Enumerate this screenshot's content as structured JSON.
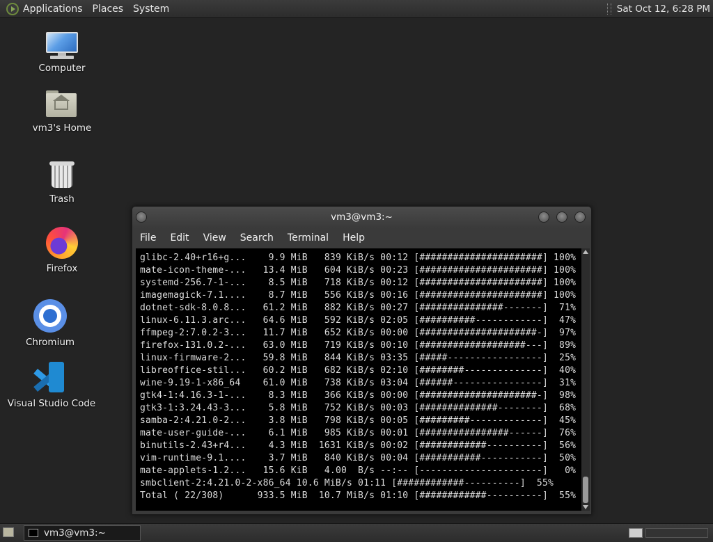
{
  "top_panel": {
    "menus": [
      "Applications",
      "Places",
      "System"
    ],
    "clock": "Sat Oct 12,  6:28 PM"
  },
  "desktop": {
    "icons": [
      {
        "label": "Computer",
        "icon": "computer-icon"
      },
      {
        "label": "vm3's Home",
        "icon": "home-folder-icon"
      },
      {
        "label": "Trash",
        "icon": "trash-icon"
      },
      {
        "label": "Firefox",
        "icon": "firefox-icon"
      },
      {
        "label": "Chromium",
        "icon": "chromium-icon"
      },
      {
        "label": "Visual Studio Code",
        "icon": "vscode-icon"
      }
    ]
  },
  "terminal": {
    "title": "vm3@vm3:~",
    "menu": [
      "File",
      "Edit",
      "View",
      "Search",
      "Terminal",
      "Help"
    ],
    "rows": [
      {
        "name": "glibc-2.40+r16+g...",
        "size": "9.9 MiB",
        "rate": "839 KiB/s",
        "time": "00:12",
        "bar": "[######################]",
        "percent": "100%"
      },
      {
        "name": "mate-icon-theme-...",
        "size": "13.4 MiB",
        "rate": "604 KiB/s",
        "time": "00:23",
        "bar": "[######################]",
        "percent": "100%"
      },
      {
        "name": "systemd-256.7-1-...",
        "size": "8.5 MiB",
        "rate": "718 KiB/s",
        "time": "00:12",
        "bar": "[######################]",
        "percent": "100%"
      },
      {
        "name": "imagemagick-7.1....",
        "size": "8.7 MiB",
        "rate": "556 KiB/s",
        "time": "00:16",
        "bar": "[######################]",
        "percent": "100%"
      },
      {
        "name": "dotnet-sdk-8.0.8...",
        "size": "61.2 MiB",
        "rate": "882 KiB/s",
        "time": "00:27",
        "bar": "[###############-------]",
        "percent": "71%"
      },
      {
        "name": "linux-6.11.3.arc...",
        "size": "64.6 MiB",
        "rate": "592 KiB/s",
        "time": "02:05",
        "bar": "[##########------------]",
        "percent": "47%"
      },
      {
        "name": "ffmpeg-2:7.0.2-3...",
        "size": "11.7 MiB",
        "rate": "652 KiB/s",
        "time": "00:00",
        "bar": "[#####################-]",
        "percent": "97%"
      },
      {
        "name": "firefox-131.0.2-...",
        "size": "63.0 MiB",
        "rate": "719 KiB/s",
        "time": "00:10",
        "bar": "[###################---]",
        "percent": "89%"
      },
      {
        "name": "linux-firmware-2...",
        "size": "59.8 MiB",
        "rate": "844 KiB/s",
        "time": "03:35",
        "bar": "[#####-----------------]",
        "percent": "25%"
      },
      {
        "name": "libreoffice-stil...",
        "size": "60.2 MiB",
        "rate": "682 KiB/s",
        "time": "02:10",
        "bar": "[########--------------]",
        "percent": "40%"
      },
      {
        "name": "wine-9.19-1-x86_64",
        "size": "61.0 MiB",
        "rate": "738 KiB/s",
        "time": "03:04",
        "bar": "[######----------------]",
        "percent": "31%"
      },
      {
        "name": "gtk4-1:4.16.3-1-...",
        "size": "8.3 MiB",
        "rate": "366 KiB/s",
        "time": "00:00",
        "bar": "[#####################-]",
        "percent": "98%"
      },
      {
        "name": "gtk3-1:3.24.43-3...",
        "size": "5.8 MiB",
        "rate": "752 KiB/s",
        "time": "00:03",
        "bar": "[##############--------]",
        "percent": "68%"
      },
      {
        "name": "samba-2:4.21.0-2...",
        "size": "3.8 MiB",
        "rate": "798 KiB/s",
        "time": "00:05",
        "bar": "[#########-------------]",
        "percent": "45%"
      },
      {
        "name": "mate-user-guide-...",
        "size": "6.1 MiB",
        "rate": "985 KiB/s",
        "time": "00:01",
        "bar": "[################------]",
        "percent": "76%"
      },
      {
        "name": "binutils-2.43+r4...",
        "size": "4.3 MiB",
        "rate": "1631 KiB/s",
        "time": "00:02",
        "bar": "[############----------]",
        "percent": "56%"
      },
      {
        "name": "vim-runtime-9.1....",
        "size": "3.7 MiB",
        "rate": "840 KiB/s",
        "time": "00:04",
        "bar": "[###########-----------]",
        "percent": "50%"
      },
      {
        "name": "mate-applets-1.2...",
        "size": "15.6 KiB",
        "rate": "4.00  B/s",
        "time": "--:--",
        "bar": "[----------------------]",
        "percent": "0%"
      },
      {
        "name": "smbclient-2:4.21.0-2-x86_64",
        "size": "10.6 MiB/s",
        "rate": "",
        "time": "01:11",
        "bar": "[############----------]",
        "percent": "55%"
      },
      {
        "name": "Total ( 22/308)",
        "size": "933.5 MiB",
        "rate": "10.7 MiB/s",
        "time": "01:10",
        "bar": "[############----------]",
        "percent": "55%"
      }
    ]
  },
  "taskbar": {
    "task_label": "vm3@vm3:~"
  }
}
